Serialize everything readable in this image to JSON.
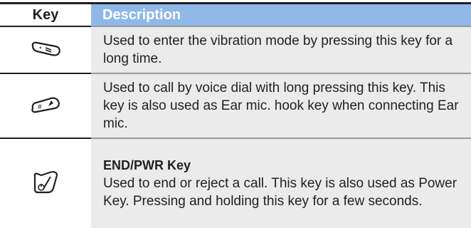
{
  "table": {
    "headers": {
      "key": "Key",
      "description": "Description"
    },
    "rows": [
      {
        "icon": "star-vibration-key-icon",
        "description": "Used to enter the vibration mode by pressing this key for a long time."
      },
      {
        "icon": "hash-voice-dial-key-icon",
        "description": "Used to call by voice dial with long pressing this key. This key is also used as Ear mic. hook key when connecting Ear mic."
      },
      {
        "icon": "end-power-key-icon",
        "title": "END/PWR Key",
        "description": "Used to end or reject a call. This key is also used as Power Key. Pressing and holding this key for a few seconds."
      }
    ]
  },
  "colors": {
    "header_accent": "#8fb8e8",
    "row_background": "#ebebeb",
    "text": "#231f20"
  }
}
